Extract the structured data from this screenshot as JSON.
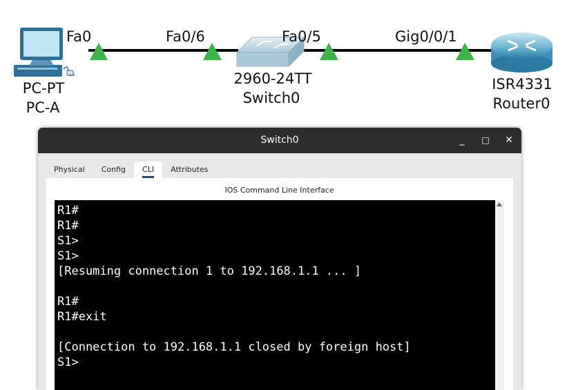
{
  "topology": {
    "pc": {
      "model": "PC-PT",
      "name": "PC-A",
      "port": "Fa0"
    },
    "switch": {
      "model": "2960-24TT",
      "name": "Switch0",
      "port_to_pc": "Fa0/6",
      "port_to_router": "Fa0/5"
    },
    "router": {
      "model": "ISR4331",
      "name": "Router0",
      "port": "Gig0/0/1"
    },
    "link_status_color": "#3cb44a"
  },
  "window": {
    "title": "Switch0",
    "controls": {
      "minimize": "_",
      "maximize": "□",
      "close": "✕"
    },
    "tabs": [
      "Physical",
      "Config",
      "CLI",
      "Attributes"
    ],
    "active_tab": "CLI",
    "cli_heading": "IOS Command Line Interface",
    "terminal_lines": [
      "R1#",
      "R1#",
      "S1>",
      "S1>",
      "[Resuming connection 1 to 192.168.1.1 ... ]",
      "",
      "R1#",
      "R1#exit",
      "",
      "[Connection to 192.168.1.1 closed by foreign host]",
      "S1>"
    ]
  }
}
